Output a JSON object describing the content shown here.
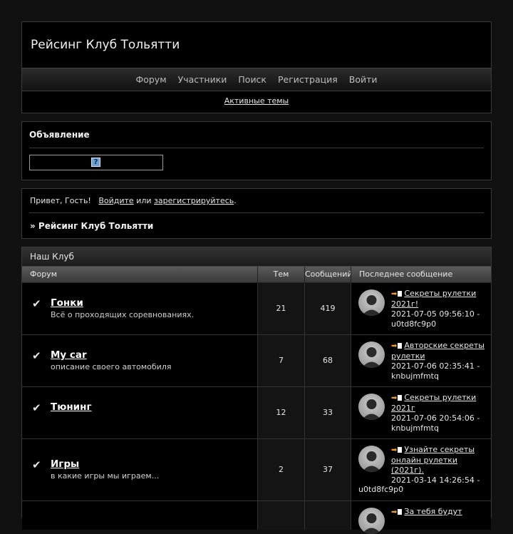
{
  "site": {
    "title": "Рейсинг Клуб Тольятти"
  },
  "nav": {
    "items": [
      "Форум",
      "Участники",
      "Поиск",
      "Регистрация",
      "Войти"
    ]
  },
  "subnav": {
    "active_topics": "Активные темы"
  },
  "announcement": {
    "title": "Объявление",
    "icon": "question-icon",
    "icon_glyph": "?"
  },
  "userinfo": {
    "greeting": "Привет, Гость!",
    "login_link": "Войдите",
    "or_text": "или",
    "register_link": "зарегистрируйтесь",
    "period": ".",
    "breadcrumb": "» Рейсинг Клуб Тольятти"
  },
  "category": {
    "title": "Наш Клуб",
    "columns": {
      "forum": "Форум",
      "topics": "Тем",
      "posts": "Сообщений",
      "last": "Последнее сообщение"
    },
    "forums": [
      {
        "name": "Гонки",
        "desc": "Всё о проходящих соревнованиях.",
        "topics": "21",
        "posts": "419",
        "last_title": "Секреты рулетки 2021г!",
        "last_date": "2021-07-05 09:56:10 -",
        "last_user": "u0td8fc9p0"
      },
      {
        "name": "My car",
        "desc": "описание своего автомобиля",
        "topics": "7",
        "posts": "68",
        "last_title": "Авторские секреты рулетки",
        "last_date": "2021-07-06 02:35:41 -",
        "last_user": "knbujmfmtq"
      },
      {
        "name": "Тюнинг",
        "desc": "",
        "topics": "12",
        "posts": "33",
        "last_title": "Секреты рулетки 2021г",
        "last_date": "2021-07-06 20:54:06 -",
        "last_user": "knbujmfmtq"
      },
      {
        "name": "Игры",
        "desc": "в какие игры мы играем...",
        "topics": "2",
        "posts": "37",
        "last_title": "Узнайте секреты онлайн рулетки (2021г).",
        "last_date": "2021-03-14 14:26:54 -",
        "last_user": "u0td8fc9p0"
      },
      {
        "name": "",
        "desc": "",
        "topics": "",
        "posts": "",
        "last_title": "За тебя будут",
        "last_date": "",
        "last_user": ""
      }
    ]
  },
  "colors": {
    "background": "#111111",
    "panel": "#000000",
    "border": "#3a3a3a",
    "arrow": "#f0a020"
  }
}
